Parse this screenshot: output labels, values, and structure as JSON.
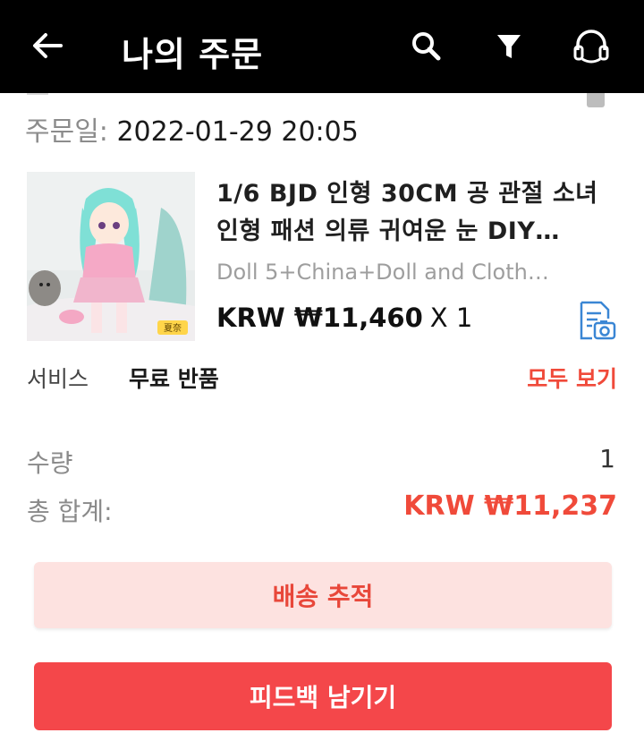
{
  "header": {
    "title": "나의 주문"
  },
  "order": {
    "date_label": "주문일:",
    "date_value": "2022-01-29 20:05"
  },
  "product": {
    "name": "1/6 BJD 인형 30CM 공 관절 소녀 인형 패션 의류 귀여운 눈 DIY…",
    "variant": "Doll 5+China+Doll and Cloth…",
    "price": "KRW ₩11,460",
    "quantity": "X 1",
    "image_label": "夏奈"
  },
  "service": {
    "label": "서비스",
    "value": "무료 반품",
    "view_all": "모두 보기"
  },
  "summary": {
    "quantity_label": "수량",
    "quantity_value": "1",
    "total_label": "총 합계:",
    "total_value": "KRW ₩11,237"
  },
  "buttons": {
    "track": "배송 추적",
    "feedback": "피드백 남기기"
  },
  "colors": {
    "accent": "#f04a3a",
    "header_bg": "#000000",
    "track_bg": "#fde2e0",
    "feedback_bg": "#f4474a"
  },
  "icons": [
    "back-arrow-icon",
    "search-icon",
    "filter-icon",
    "headset-support-icon",
    "snapshot-icon"
  ]
}
